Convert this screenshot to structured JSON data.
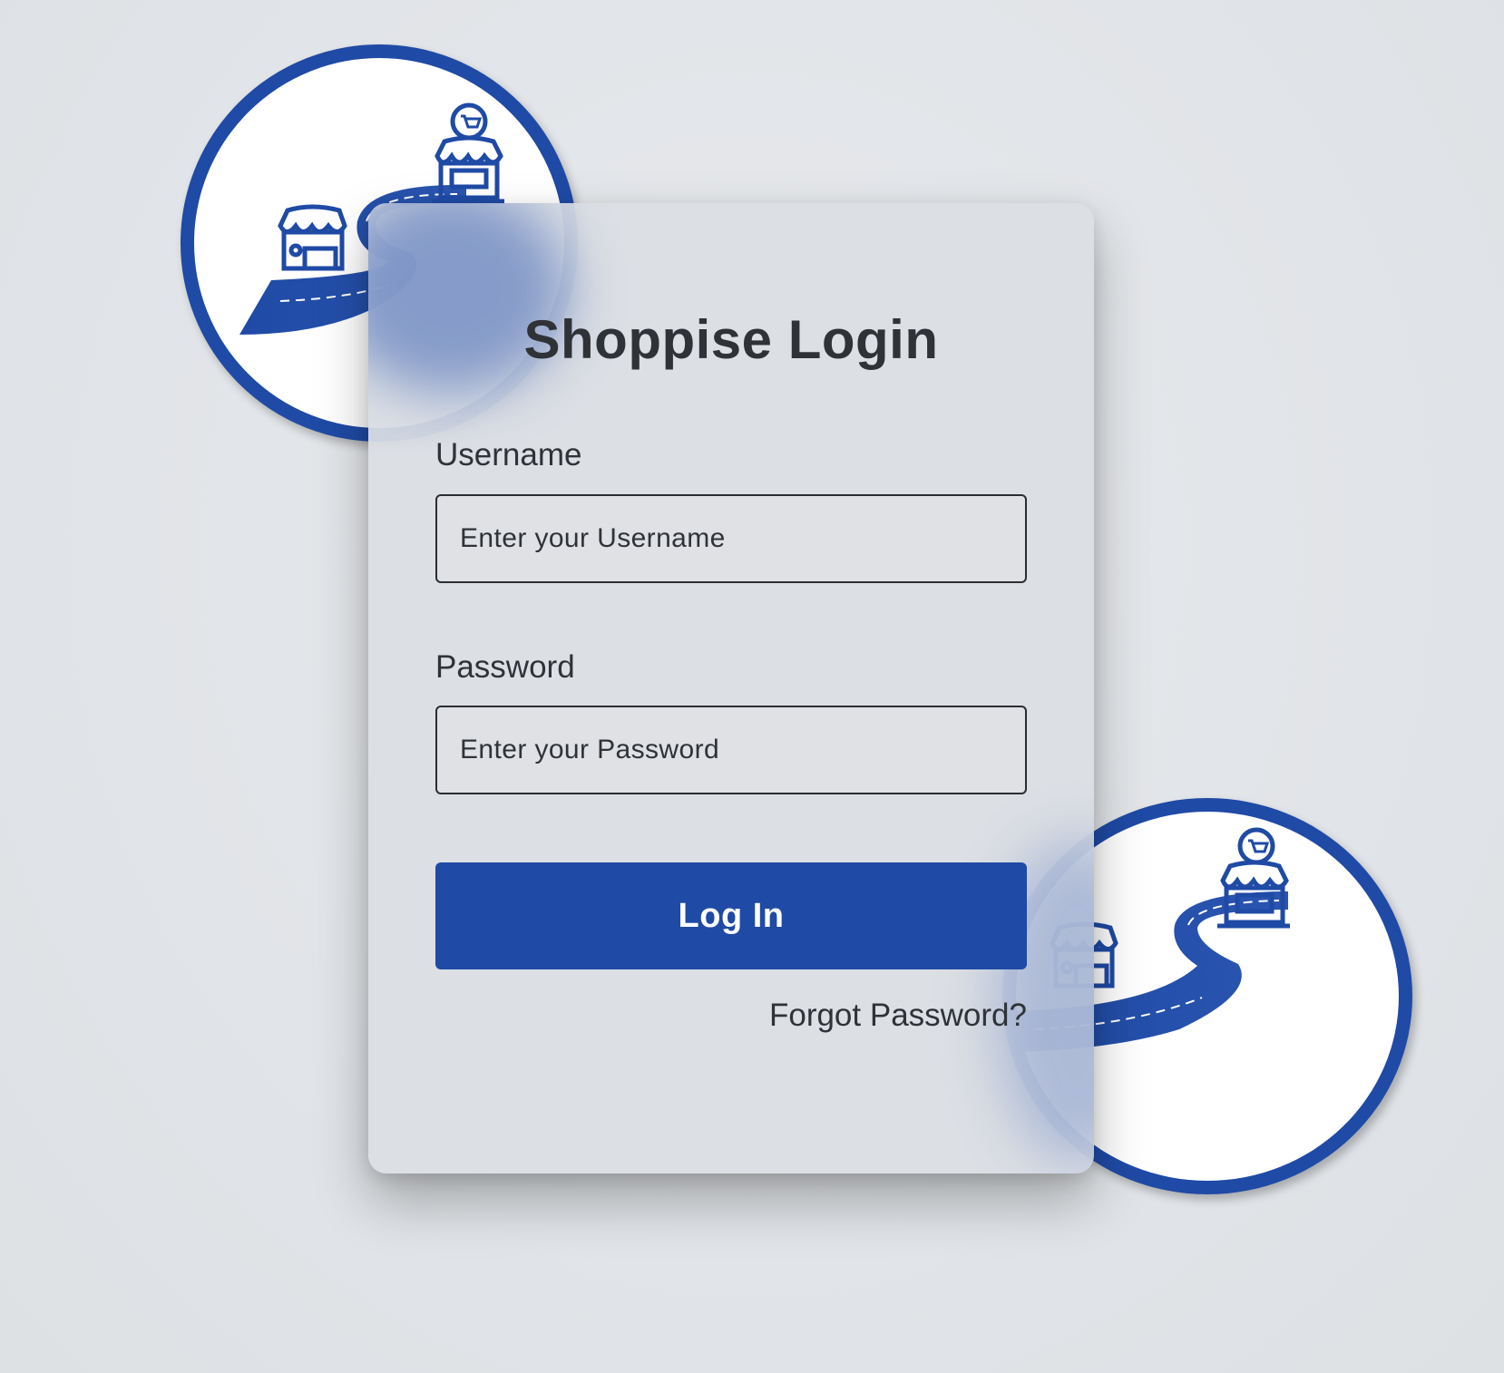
{
  "app": {
    "title": "Shoppise Login"
  },
  "form": {
    "username_label": "Username",
    "username_placeholder": "Enter your Username",
    "username_value": "",
    "password_label": "Password",
    "password_placeholder": "Enter your Password",
    "password_value": "",
    "login_label": "Log In",
    "forgot_label": "Forgot Password?"
  },
  "decor": {
    "top_badge_icon": "shop-road-icon",
    "bottom_badge_icon": "shop-road-icon"
  },
  "colors": {
    "accent": "#1f4aa5",
    "text": "#2f3338",
    "card": "#dbdee3",
    "background": "#e3e6e9"
  }
}
